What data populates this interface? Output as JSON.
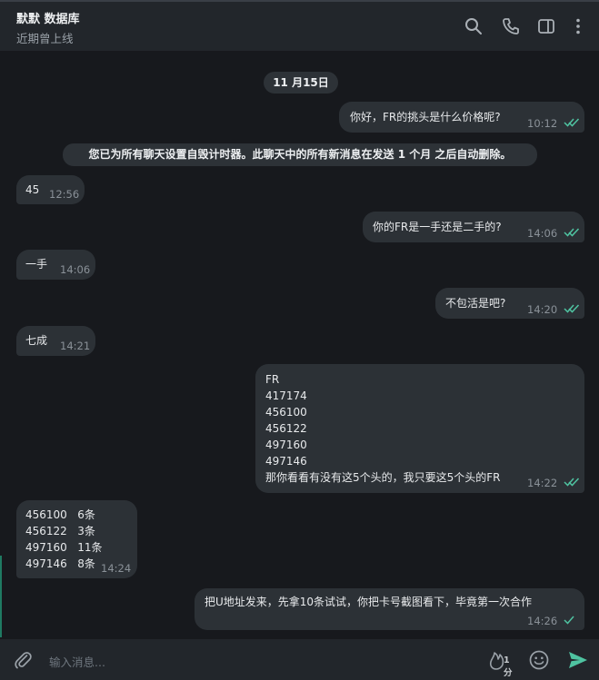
{
  "header": {
    "title": "默默 数据库",
    "status": "近期曾上线",
    "icons": [
      "search-icon",
      "phone-icon",
      "sidebar-icon",
      "more-vert-icon"
    ]
  },
  "chat": {
    "date": "11 月15日",
    "system_notice": "您已为所有聊天设置自毁计时器。此聊天中的所有新消息在发送 1 个月 之后自动删除。",
    "messages": [
      {
        "dir": "out",
        "text": "你好，FR的挑头是什么价格呢?",
        "time": "10:12",
        "read": true
      },
      {
        "dir": "in",
        "text": "45",
        "time": "12:56"
      },
      {
        "dir": "out",
        "text": "你的FR是一手还是二手的?",
        "time": "14:06",
        "read": true
      },
      {
        "dir": "in",
        "text": "一手",
        "time": "14:06"
      },
      {
        "dir": "out",
        "text": "不包活是吧?",
        "time": "14:20",
        "read": true
      },
      {
        "dir": "in",
        "text": "七成",
        "time": "14:21"
      },
      {
        "dir": "out",
        "text": "FR\n417174\n456100\n456122\n497160\n497146\n那你看看有没有这5个头的，我只要这5个头的FR",
        "time": "14:22",
        "read": true
      },
      {
        "dir": "in",
        "text": "456100   6条\n456122   3条\n497160   11条\n497146   8条",
        "time": "14:24"
      },
      {
        "dir": "out",
        "text": "把U地址发来，先拿10条试试，你把卡号截图看下，毕竟第一次合作",
        "time": "14:26",
        "read": false
      }
    ]
  },
  "input": {
    "placeholder": "输入消息...",
    "timer_label": "1分",
    "icons": [
      "attach-icon",
      "timer-icon",
      "emoji-icon",
      "send-icon"
    ]
  },
  "colors": {
    "background": "#17191d",
    "header": "#22262b",
    "bubble": "#2c3136",
    "accent": "#4fc3a1"
  }
}
